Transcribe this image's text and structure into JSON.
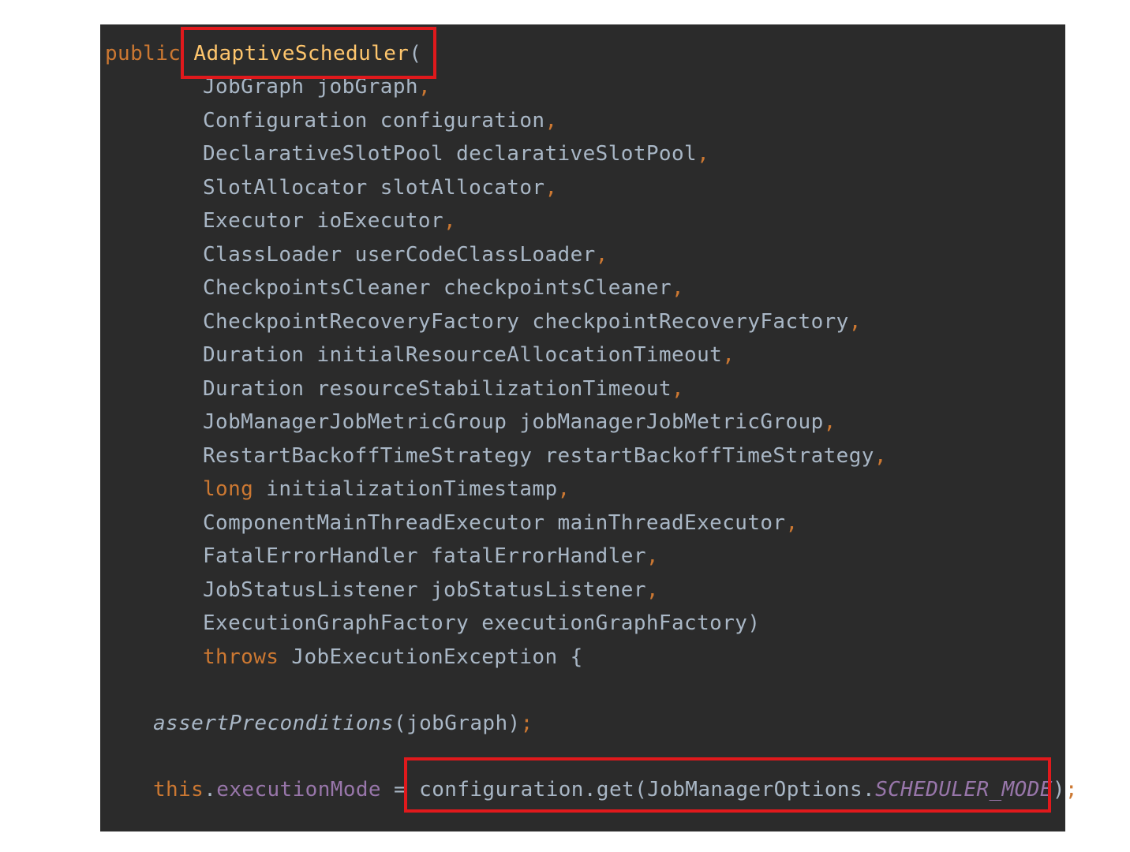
{
  "code": {
    "header": {
      "keyword": "public",
      "method": "AdaptiveScheduler",
      "open_paren": "("
    },
    "params": [
      {
        "type": "JobGraph",
        "name": "jobGraph",
        "sep": ","
      },
      {
        "type": "Configuration",
        "name": "configuration",
        "sep": ","
      },
      {
        "type": "DeclarativeSlotPool",
        "name": "declarativeSlotPool",
        "sep": ","
      },
      {
        "type": "SlotAllocator",
        "name": "slotAllocator",
        "sep": ","
      },
      {
        "type": "Executor",
        "name": "ioExecutor",
        "sep": ","
      },
      {
        "type": "ClassLoader",
        "name": "userCodeClassLoader",
        "sep": ","
      },
      {
        "type": "CheckpointsCleaner",
        "name": "checkpointsCleaner",
        "sep": ","
      },
      {
        "type": "CheckpointRecoveryFactory",
        "name": "checkpointRecoveryFactory",
        "sep": ","
      },
      {
        "type": "Duration",
        "name": "initialResourceAllocationTimeout",
        "sep": ","
      },
      {
        "type": "Duration",
        "name": "resourceStabilizationTimeout",
        "sep": ","
      },
      {
        "type": "JobManagerJobMetricGroup",
        "name": "jobManagerJobMetricGroup",
        "sep": ","
      },
      {
        "type": "RestartBackoffTimeStrategy",
        "name": "restartBackoffTimeStrategy",
        "sep": ","
      },
      {
        "type": "long",
        "name": "initializationTimestamp",
        "sep": ","
      },
      {
        "type": "ComponentMainThreadExecutor",
        "name": "mainThreadExecutor",
        "sep": ","
      },
      {
        "type": "FatalErrorHandler",
        "name": "fatalErrorHandler",
        "sep": ","
      },
      {
        "type": "JobStatusListener",
        "name": "jobStatusListener",
        "sep": ","
      },
      {
        "type": "ExecutionGraphFactory",
        "name": "executionGraphFactory",
        "sep": ")"
      }
    ],
    "throws_line": {
      "keyword": "throws",
      "exception": "JobExecutionException {"
    },
    "precondition_line": {
      "call": "assertPreconditions",
      "args": "(jobGraph)",
      "semicolon": ";"
    },
    "assignment_line": {
      "this_kw": "this",
      "dot": ".",
      "field": "executionMode",
      "equals": " = ",
      "call": "configuration.get(JobManagerOptions.",
      "constant": "SCHEDULER_MODE",
      "close": ")",
      "semicolon": ";"
    }
  },
  "colors": {
    "background": "#2b2b2b",
    "default_text": "#a9b7c6",
    "keyword": "#cc7832",
    "method_declaration": "#ffc66d",
    "field": "#9876aa",
    "highlight_border": "#e0191c"
  }
}
